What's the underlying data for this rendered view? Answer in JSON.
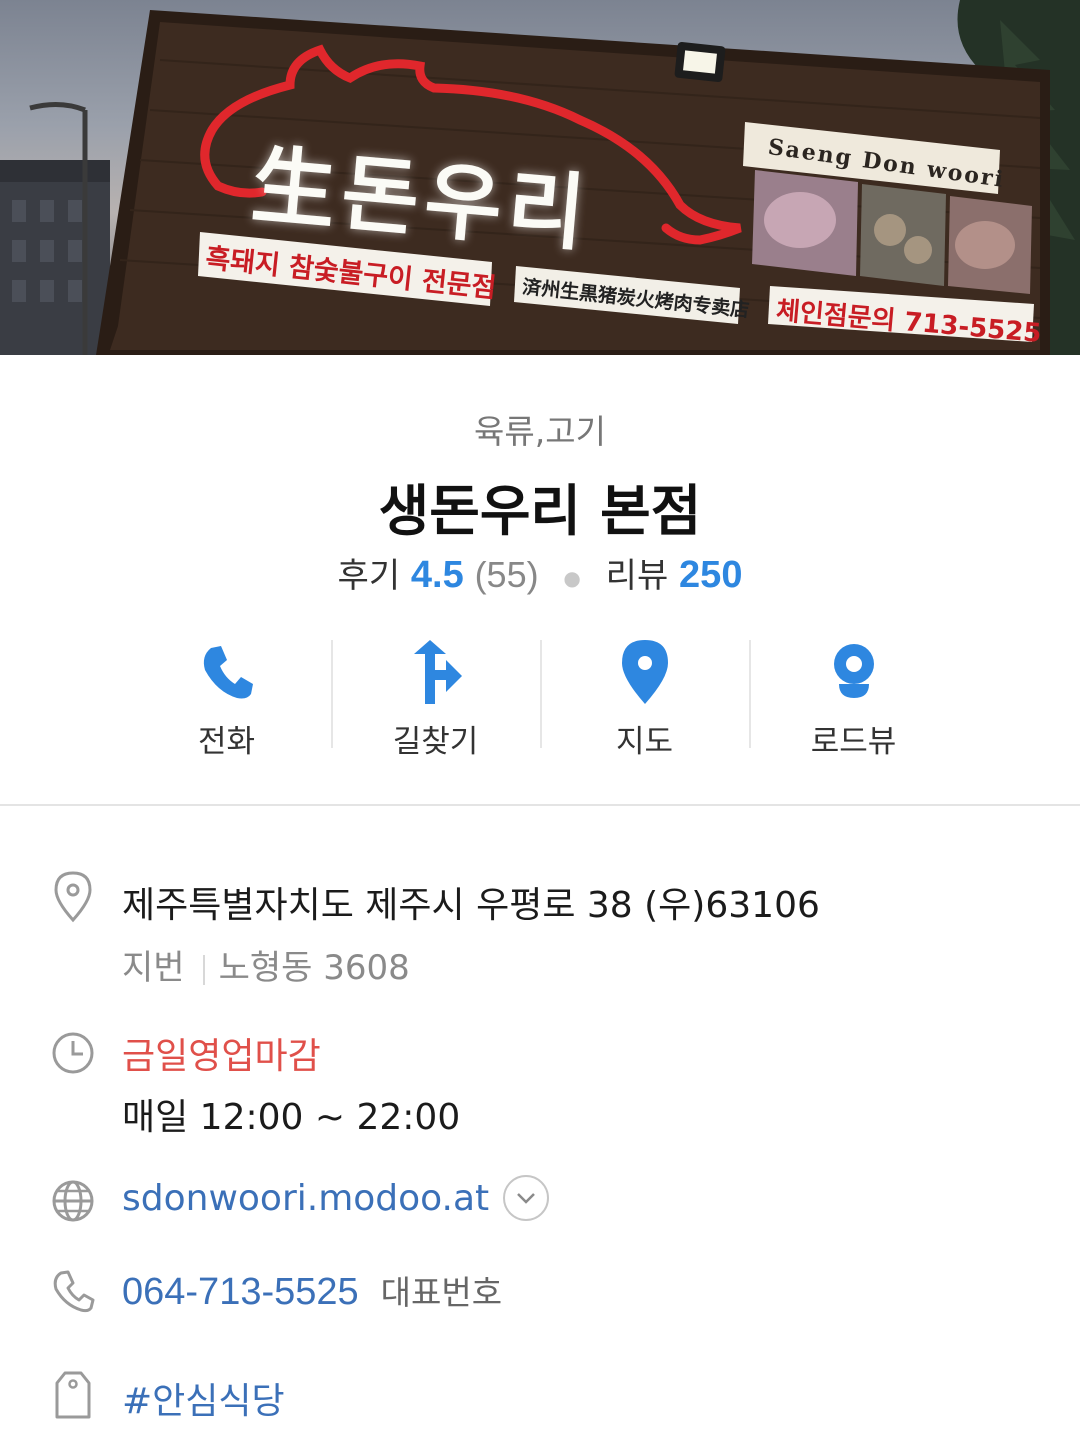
{
  "hero": {
    "sign_main": "生돈우리",
    "sign_en": "Saeng Don woori",
    "sign_kr": "흑돼지 참숯불구이 전문점",
    "sign_cn": "済州生黒猪炭火烤肉专卖店",
    "sign_phone": "체인점문의 713-5525"
  },
  "place": {
    "category": "육류,고기",
    "name": "생돈우리 본점",
    "review_label": "후기",
    "review_score": "4.5",
    "review_count": "(55)",
    "blog_label": "리뷰",
    "blog_count": "250"
  },
  "actions": [
    {
      "label": "전화",
      "icon": "phone-icon"
    },
    {
      "label": "길찾기",
      "icon": "directions-icon"
    },
    {
      "label": "지도",
      "icon": "map-pin-icon"
    },
    {
      "label": "로드뷰",
      "icon": "roadview-icon"
    }
  ],
  "info": {
    "address": "제주특별자치도 제주시 우평로 38 (우)63106",
    "jibun_label": "지번",
    "jibun_value": "노형동 3608",
    "status": "금일영업마감",
    "hours": "매일 12:00 ~ 22:00",
    "website": "sdonwoori.modoo.at",
    "phone": "064-713-5525",
    "phone_sub": "대표번호",
    "tag": "#안심식당"
  },
  "colors": {
    "accent_blue": "#2e87e0",
    "link_blue": "#3b70b8",
    "status_red": "#e0504a"
  }
}
